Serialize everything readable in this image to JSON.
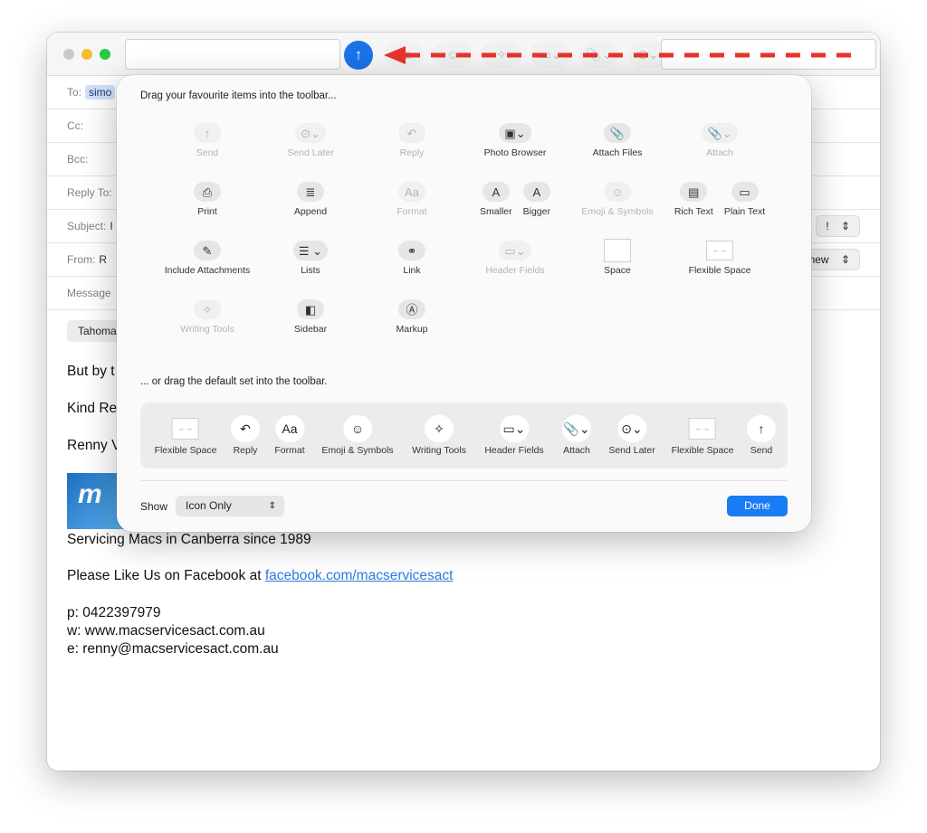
{
  "compose": {
    "headers": {
      "to_label": "To:",
      "to_value": "simo",
      "cc_label": "Cc:",
      "bcc_label": "Bcc:",
      "reply_to_label": "Reply To:",
      "subject_label": "Subject:",
      "subject_value": "I",
      "from_label": "From:",
      "from_value": "R",
      "message_label": "Message",
      "priority_value": "!",
      "from_right_value": "new"
    },
    "font_value": "Tahoma",
    "body": {
      "line1": "But by t",
      "line2": "Kind Re",
      "line3": "Renny V",
      "logo_text": "m",
      "servicing": "Servicing Macs in Canberra since 1989",
      "like_prefix": "Please Like Us on Facebook at ",
      "like_link": "facebook.com/macservicesact",
      "phone": "p: 0422397979",
      "web": "w: www.macservicesact.com.au",
      "email": "e: renny@macservicesact.com.au"
    }
  },
  "sheet": {
    "title": "Drag your favourite items into the toolbar...",
    "items": [
      {
        "label": "Send",
        "icon": "↑",
        "dim": true
      },
      {
        "label": "Send Later",
        "icon": "⊙⌄",
        "dim": true
      },
      {
        "label": "Reply",
        "icon": "↶",
        "dim": true
      },
      {
        "label": "Photo Browser",
        "icon": "▣⌄",
        "dim": false
      },
      {
        "label": "Attach Files",
        "icon": "📎",
        "dim": false
      },
      {
        "label": "Attach",
        "icon": "📎⌄",
        "dim": true
      },
      {
        "label": "Print",
        "icon": "⎙",
        "dim": false
      },
      {
        "label": "Append",
        "icon": "≣",
        "dim": false
      },
      {
        "label": "Format",
        "icon": "Aa",
        "dim": true
      },
      {
        "label_a": "Smaller",
        "label_b": "Bigger",
        "icon_a": "A",
        "icon_b": "A",
        "dim": false
      },
      {
        "label": "Emoji & Symbols",
        "icon": "☺",
        "dim": true
      },
      {
        "label_a": "Rich Text",
        "label_b": "Plain Text",
        "icon_a": "▤",
        "icon_b": "▭",
        "dim": false
      },
      {
        "label": "Include Attachments",
        "icon": "✎",
        "dim": false
      },
      {
        "label": "Lists",
        "icon": "☰ ⌄",
        "dim": false
      },
      {
        "label": "Link",
        "icon": "⚭",
        "dim": false
      },
      {
        "label": "Header Fields",
        "icon": "▭⌄",
        "dim": true
      },
      {
        "label": "Space",
        "icon": "",
        "dim": false
      },
      {
        "label": "Flexible Space",
        "icon": "←→",
        "dim": false
      },
      {
        "label": "Writing Tools",
        "icon": "✧",
        "dim": true
      },
      {
        "label": "Sidebar",
        "icon": "◧",
        "dim": false
      },
      {
        "label": "Markup",
        "icon": "Ⓐ",
        "dim": false
      }
    ],
    "default_label": "... or drag the default set into the toolbar.",
    "default_items": [
      {
        "label": "Flexible Space",
        "icon": "←→"
      },
      {
        "label": "Reply",
        "icon": "↶"
      },
      {
        "label": "Format",
        "icon": "Aa"
      },
      {
        "label": "Emoji & Symbols",
        "icon": "☺"
      },
      {
        "label": "Writing Tools",
        "icon": "✧"
      },
      {
        "label": "Header Fields",
        "icon": "▭⌄"
      },
      {
        "label": "Attach",
        "icon": "📎⌄"
      },
      {
        "label": "Send Later",
        "icon": "⊙⌄"
      },
      {
        "label": "Flexible Space",
        "icon": "←→"
      },
      {
        "label": "Send",
        "icon": "↑"
      }
    ],
    "show_label": "Show",
    "show_value": "Icon Only",
    "done_label": "Done"
  },
  "toolbar": {
    "send_icon": "↑",
    "ghost_icons": [
      "Aa",
      "☺",
      "✧",
      "▭⌄",
      "📎⌄",
      "⊙⌄"
    ],
    "arrow_color": "#e8332a"
  }
}
